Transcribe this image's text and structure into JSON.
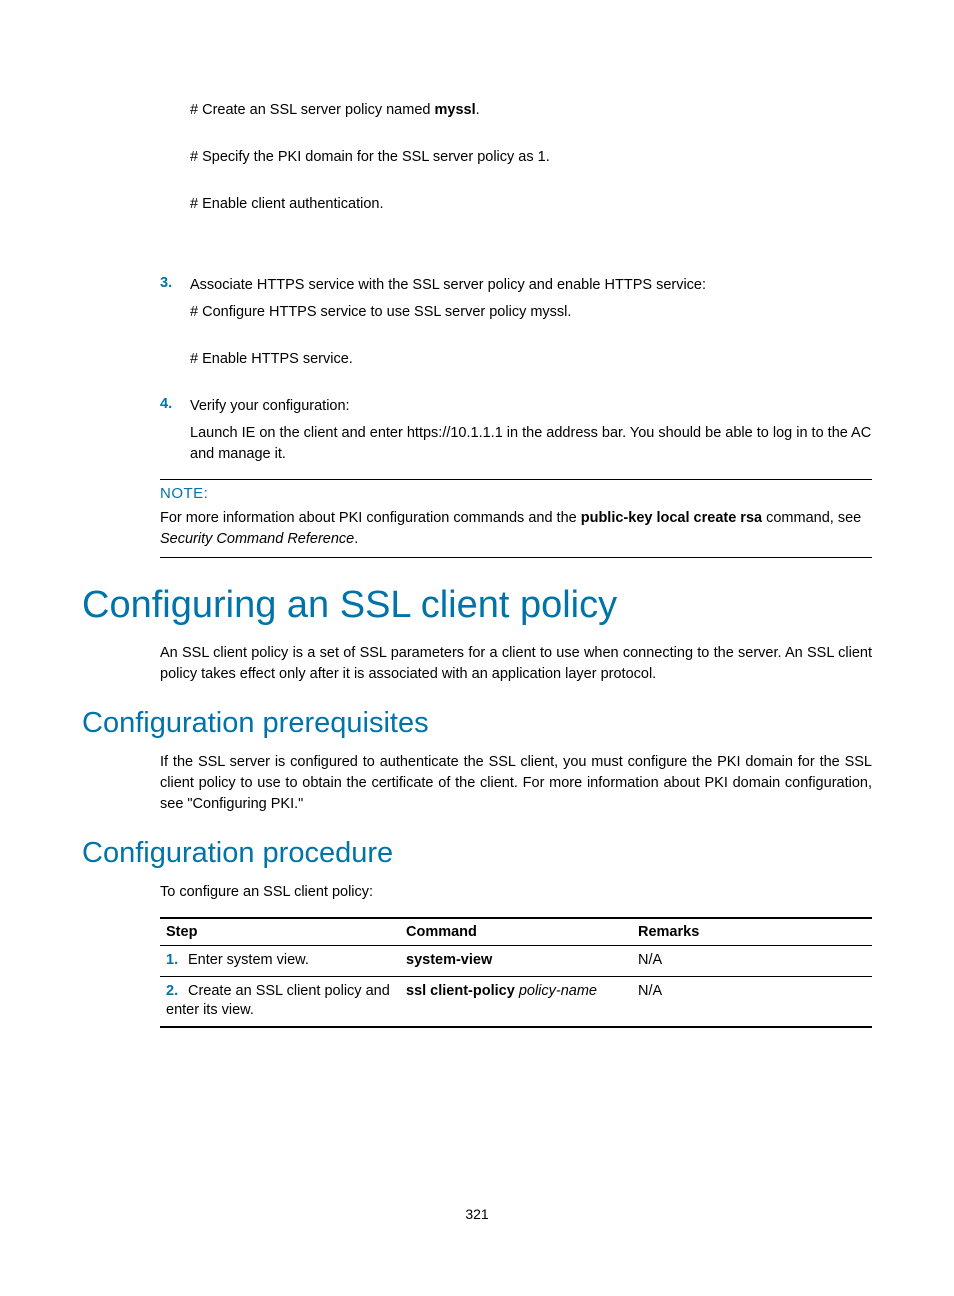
{
  "steps_top": {
    "s1": "# Create an SSL server policy named ",
    "s1_bold": "myssl",
    "s1_end": ".",
    "s2": "# Specify the PKI domain for the SSL server policy as 1.",
    "s3": "# Enable client authentication."
  },
  "step3": {
    "num": "3.",
    "text": "Associate HTTPS service with the SSL server policy and enable HTTPS service:",
    "sub1": "# Configure HTTPS service to use SSL server policy myssl.",
    "sub2": "# Enable HTTPS service."
  },
  "step4": {
    "num": "4.",
    "text": "Verify your configuration:",
    "sub1": "Launch IE on the client and enter https://10.1.1.1 in the address bar. You should be able to log in to the AC and manage it."
  },
  "note": {
    "label": "NOTE:",
    "text1": "For more information about PKI configuration commands and the ",
    "bold": "public-key local create rsa",
    "text2": " command, see ",
    "italic": "Security Command Reference",
    "text3": "."
  },
  "h1": "Configuring an SSL client policy",
  "para1": "An SSL client policy is a set of SSL parameters for a client to use when connecting to the server. An SSL client policy takes effect only after it is associated with an application layer protocol.",
  "h2a": "Configuration prerequisites",
  "para2": "If the SSL server is configured to authenticate the SSL client, you must configure the PKI domain for the SSL client policy to use to obtain the certificate of the client. For more information about PKI domain configuration, see \"Configuring PKI.\"",
  "h2b": "Configuration procedure",
  "para3": "To configure an SSL client policy:",
  "table": {
    "headers": {
      "step": "Step",
      "command": "Command",
      "remarks": "Remarks"
    },
    "rows": [
      {
        "num": "1.",
        "step": "Enter system view.",
        "cmd_bold": "system-view",
        "cmd_italic": "",
        "remarks": "N/A"
      },
      {
        "num": "2.",
        "step": "Create an SSL client policy and enter its view.",
        "cmd_bold": "ssl client-policy ",
        "cmd_italic": "policy-name",
        "remarks": "N/A"
      }
    ]
  },
  "page_number": "321"
}
